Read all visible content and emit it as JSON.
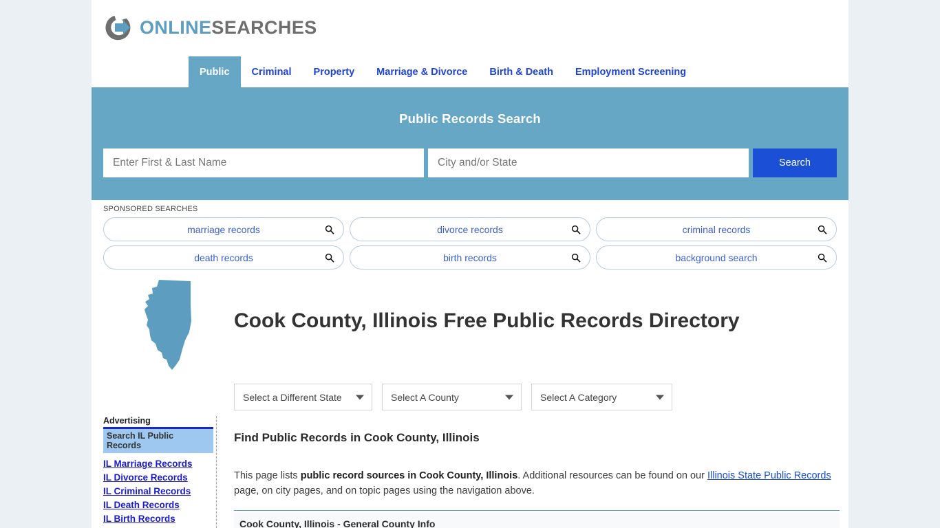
{
  "site": {
    "logo_primary": "ONLINE",
    "logo_secondary": "SEARCHES",
    "logo_icon": "circle-arrow-logo-icon",
    "accent_teal": "#66a7c5",
    "accent_blue": "#1a4fd6",
    "page_bg": "#eaf0f4"
  },
  "nav": {
    "items": [
      {
        "label": "Public",
        "active": true
      },
      {
        "label": "Criminal",
        "active": false
      },
      {
        "label": "Property",
        "active": false
      },
      {
        "label": "Marriage & Divorce",
        "active": false
      },
      {
        "label": "Birth & Death",
        "active": false
      },
      {
        "label": "Employment Screening",
        "active": false
      }
    ]
  },
  "search_banner": {
    "title": "Public Records Search",
    "name_placeholder": "Enter First & Last Name",
    "name_value": "",
    "city_placeholder": "City and/or State",
    "city_value": "",
    "button_label": "Search"
  },
  "sponsored": {
    "label": "SPONSORED SEARCHES",
    "rows": [
      [
        {
          "label": "marriage records",
          "icon": "magnifier-icon"
        },
        {
          "label": "divorce records",
          "icon": "magnifier-icon"
        },
        {
          "label": "criminal records",
          "icon": "magnifier-icon"
        }
      ],
      [
        {
          "label": "death records",
          "icon": "magnifier-icon"
        },
        {
          "label": "birth records",
          "icon": "magnifier-icon"
        },
        {
          "label": "background search",
          "icon": "magnifier-icon"
        }
      ]
    ]
  },
  "hero": {
    "state_map_icon": "illinois-state-map-icon",
    "title": "Cook County, Illinois Free Public Records Directory"
  },
  "dropdowns": [
    {
      "name": "state",
      "selected": "Select a Different State"
    },
    {
      "name": "county",
      "selected": "Select A County"
    },
    {
      "name": "category",
      "selected": "Select A Category"
    }
  ],
  "main": {
    "section_heading": "Find Public Records in Cook County, Illinois",
    "paragraph": {
      "part1": "This page lists ",
      "bold": "public record sources in Cook County, Illinois",
      "part2": ". Additional resources can be found on our ",
      "link": "Illinois State Public Records",
      "part3": " page, on city pages, and on topic pages using the navigation above."
    },
    "table_title": "Cook County, Illinois - General County Info"
  },
  "sidebar": {
    "ad_label": "Advertising",
    "ad_heading": "Search IL Public Records",
    "links": [
      "IL Marriage Records",
      "IL Divorce Records",
      "IL Criminal Records",
      "IL Death Records",
      "IL Birth Records"
    ]
  }
}
